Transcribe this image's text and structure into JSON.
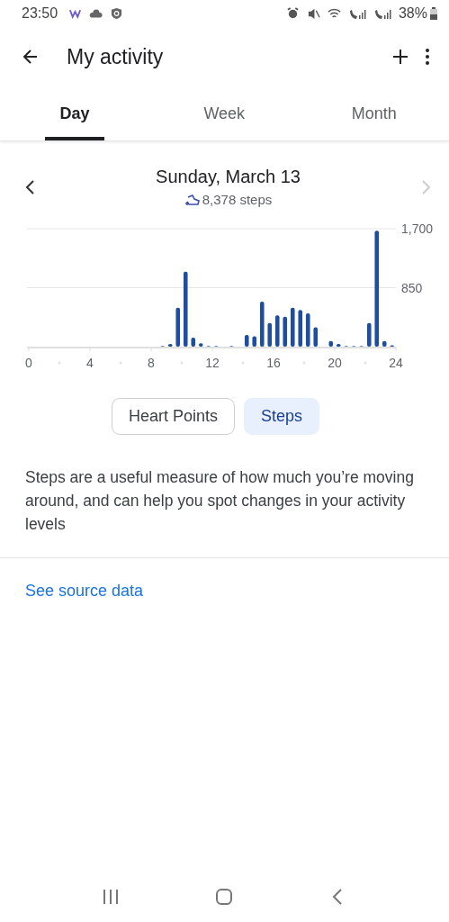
{
  "status_bar": {
    "time": "23:50",
    "battery": "38%"
  },
  "app_bar": {
    "title": "My activity"
  },
  "tabs": [
    {
      "label": "Day",
      "selected": true
    },
    {
      "label": "Week",
      "selected": false
    },
    {
      "label": "Month",
      "selected": false
    }
  ],
  "date": "Sunday, March 13",
  "total": "8,378 steps",
  "chart_data": {
    "type": "bar",
    "x": [
      0.25,
      0.75,
      1.25,
      1.75,
      2.25,
      2.75,
      3.25,
      3.75,
      4.25,
      4.75,
      5.25,
      5.75,
      6.25,
      6.75,
      7.25,
      7.75,
      8.25,
      8.75,
      9.25,
      9.75,
      10.25,
      10.75,
      11.25,
      11.75,
      12.25,
      12.75,
      13.25,
      13.75,
      14.25,
      14.75,
      15.25,
      15.75,
      16.25,
      16.75,
      17.25,
      17.75,
      18.25,
      18.75,
      19.25,
      19.75,
      20.25,
      20.75,
      21.25,
      21.75,
      22.25,
      22.75,
      23.25,
      23.75
    ],
    "values": [
      0,
      0,
      0,
      0,
      0,
      0,
      0,
      0,
      0,
      0,
      0,
      0,
      0,
      0,
      0,
      0,
      0,
      10,
      40,
      560,
      1080,
      130,
      50,
      10,
      10,
      0,
      10,
      0,
      170,
      150,
      650,
      340,
      450,
      430,
      560,
      530,
      480,
      280,
      0,
      80,
      40,
      10,
      10,
      10,
      340,
      1670,
      80,
      20
    ],
    "xlim": [
      0,
      24
    ],
    "ylim": [
      0,
      1700
    ],
    "xticks": [
      0,
      4,
      8,
      12,
      16,
      20,
      24
    ],
    "yticks": [
      {
        "value": 850,
        "label": "850"
      },
      {
        "value": 1700,
        "label": "1,700"
      }
    ]
  },
  "metric_buttons": [
    {
      "label": "Heart Points",
      "selected": false
    },
    {
      "label": "Steps",
      "selected": true
    }
  ],
  "description": "Steps are a useful measure of how much you’re moving around, and can help you spot changes in your activity levels",
  "link": "See source data"
}
